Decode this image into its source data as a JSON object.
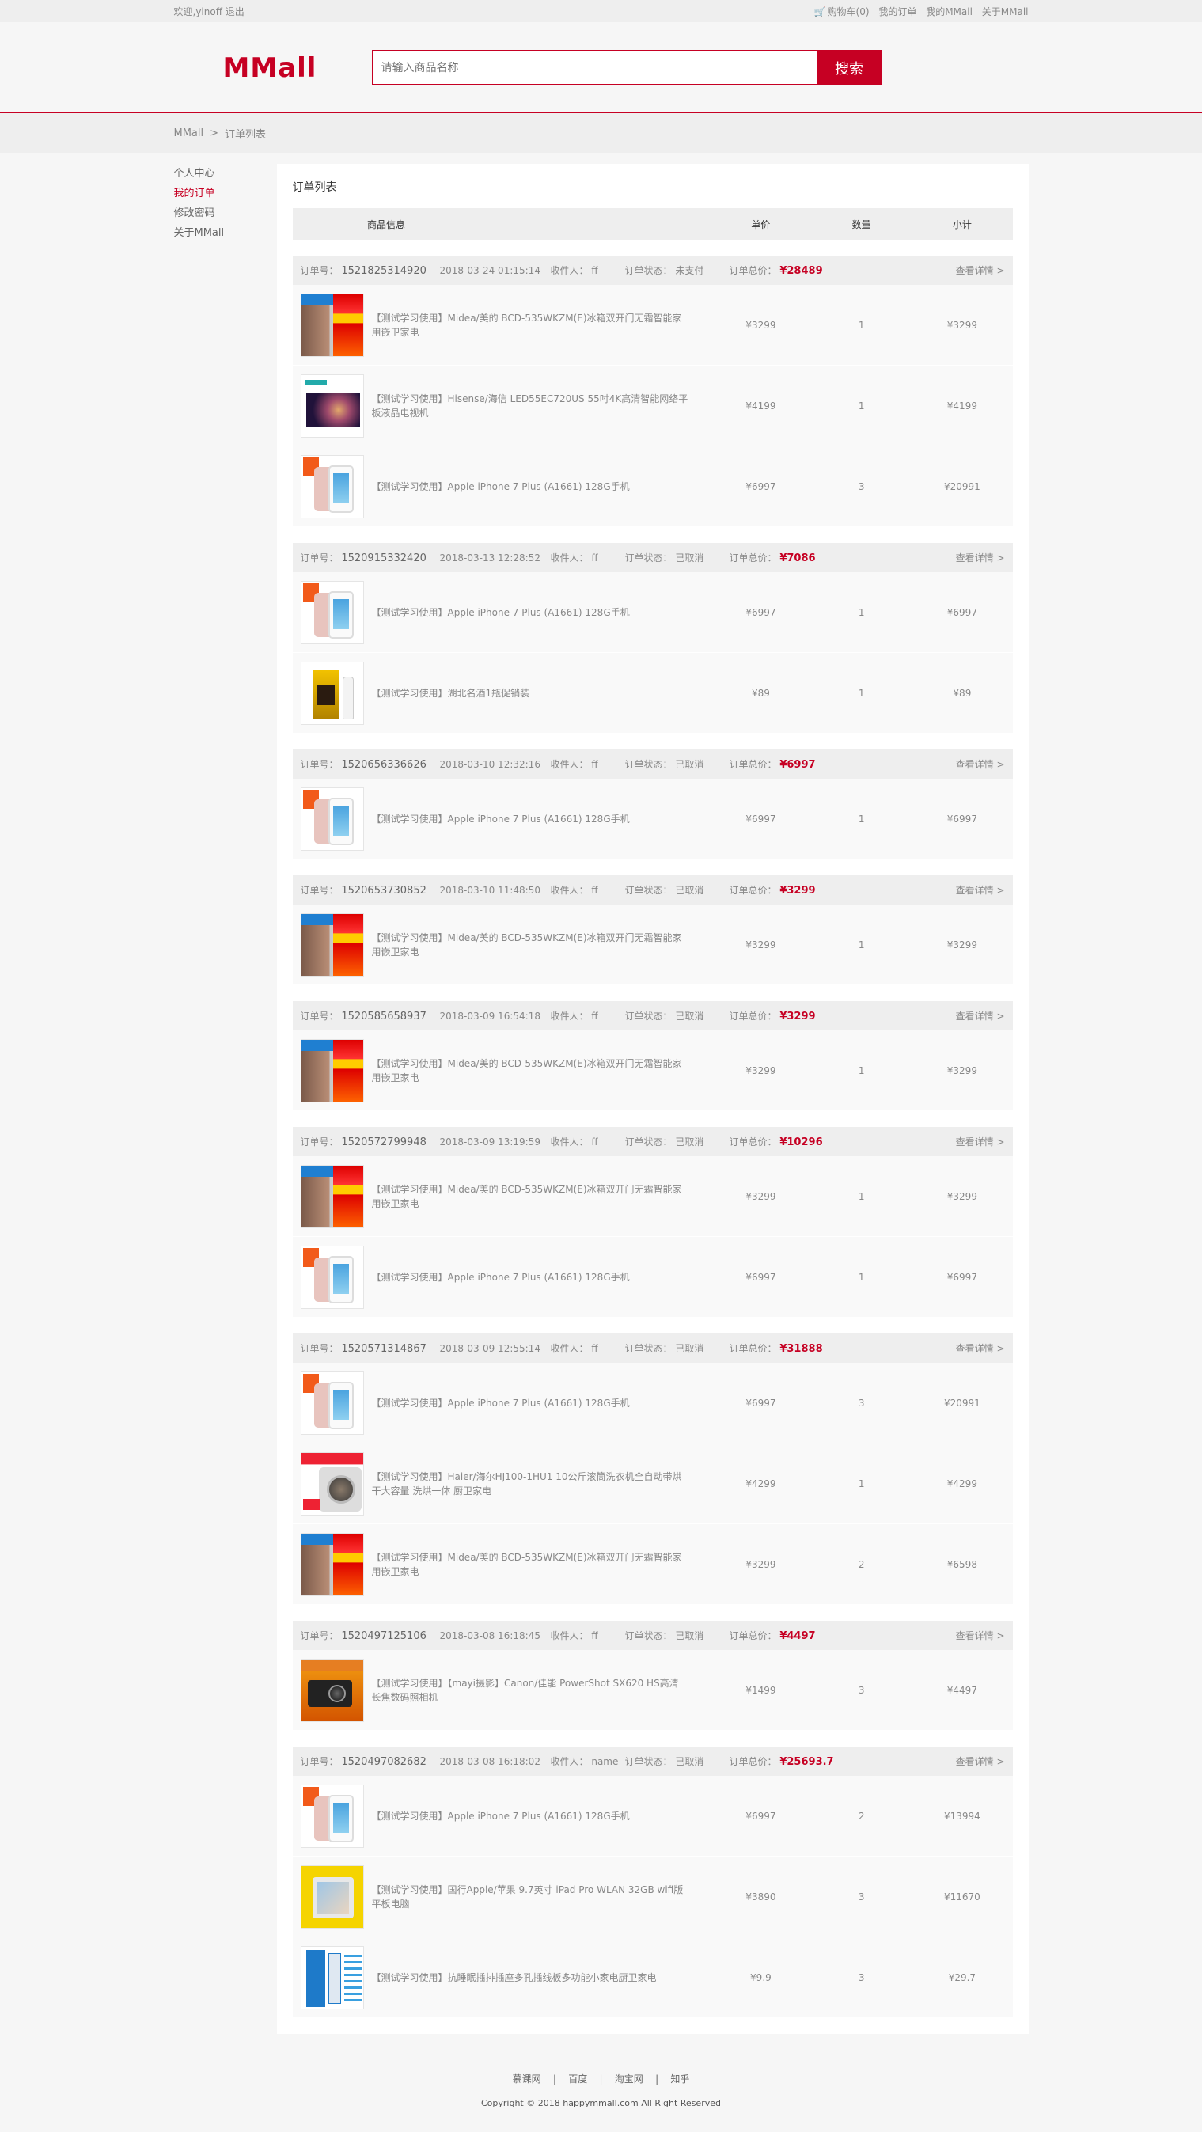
{
  "topbar": {
    "welcome": "欢迎,yinoff",
    "logout": "退出",
    "cart": "购物车(0)",
    "my_orders": "我的订单",
    "my_mmall": "我的MMall",
    "about": "关于MMall"
  },
  "header": {
    "logo": "MMall",
    "search_placeholder": "请输入商品名称",
    "search_button": "搜索"
  },
  "breadcrumb": {
    "home": "MMall",
    "sep": ">",
    "current": "订单列表"
  },
  "sidebar": {
    "items": [
      {
        "label": "个人中心",
        "active": false
      },
      {
        "label": "我的订单",
        "active": true
      },
      {
        "label": "修改密码",
        "active": false
      },
      {
        "label": "关于MMall",
        "active": false
      }
    ]
  },
  "content": {
    "title": "订单列表",
    "columns": [
      "商品信息",
      "单价",
      "数量",
      "小计"
    ]
  },
  "labels": {
    "order_no": "订单号：",
    "receiver": "收件人：",
    "status": "订单状态：",
    "total": "订单总价：",
    "detail": "查看详情 >"
  },
  "orders": [
    {
      "no": "1521825314920",
      "time": "2018-03-24 01:15:14",
      "receiver": "ff",
      "status": "未支付",
      "total": "¥28489",
      "items": [
        {
          "img": "fridge",
          "name": "【测试学习使用】Midea/美的 BCD-535WKZM(E)冰箱双开门无霜智能家用嵌卫家电",
          "price": "¥3299",
          "qty": "1",
          "subtotal": "¥3299"
        },
        {
          "img": "tv",
          "name": "【测试学习使用】Hisense/海信 LED55EC720US 55吋4K高清智能网络平板液晶电视机",
          "price": "¥4199",
          "qty": "1",
          "subtotal": "¥4199"
        },
        {
          "img": "phone",
          "name": "【测试学习使用】Apple iPhone 7 Plus (A1661) 128G手机",
          "price": "¥6997",
          "qty": "3",
          "subtotal": "¥20991"
        }
      ]
    },
    {
      "no": "1520915332420",
      "time": "2018-03-13 12:28:52",
      "receiver": "ff",
      "status": "已取消",
      "total": "¥7086",
      "items": [
        {
          "img": "phone",
          "name": "【测试学习使用】Apple iPhone 7 Plus (A1661) 128G手机",
          "price": "¥6997",
          "qty": "1",
          "subtotal": "¥6997"
        },
        {
          "img": "wine",
          "name": "【测试学习使用】湖北名酒1瓶促销装",
          "price": "¥89",
          "qty": "1",
          "subtotal": "¥89"
        }
      ]
    },
    {
      "no": "1520656336626",
      "time": "2018-03-10 12:32:16",
      "receiver": "ff",
      "status": "已取消",
      "total": "¥6997",
      "items": [
        {
          "img": "phone",
          "name": "【测试学习使用】Apple iPhone 7 Plus (A1661) 128G手机",
          "price": "¥6997",
          "qty": "1",
          "subtotal": "¥6997"
        }
      ]
    },
    {
      "no": "1520653730852",
      "time": "2018-03-10 11:48:50",
      "receiver": "ff",
      "status": "已取消",
      "total": "¥3299",
      "items": [
        {
          "img": "fridge",
          "name": "【测试学习使用】Midea/美的 BCD-535WKZM(E)冰箱双开门无霜智能家用嵌卫家电",
          "price": "¥3299",
          "qty": "1",
          "subtotal": "¥3299"
        }
      ]
    },
    {
      "no": "1520585658937",
      "time": "2018-03-09 16:54:18",
      "receiver": "ff",
      "status": "已取消",
      "total": "¥3299",
      "items": [
        {
          "img": "fridge",
          "name": "【测试学习使用】Midea/美的 BCD-535WKZM(E)冰箱双开门无霜智能家用嵌卫家电",
          "price": "¥3299",
          "qty": "1",
          "subtotal": "¥3299"
        }
      ]
    },
    {
      "no": "1520572799948",
      "time": "2018-03-09 13:19:59",
      "receiver": "ff",
      "status": "已取消",
      "total": "¥10296",
      "items": [
        {
          "img": "fridge",
          "name": "【测试学习使用】Midea/美的 BCD-535WKZM(E)冰箱双开门无霜智能家用嵌卫家电",
          "price": "¥3299",
          "qty": "1",
          "subtotal": "¥3299"
        },
        {
          "img": "phone",
          "name": "【测试学习使用】Apple iPhone 7 Plus (A1661) 128G手机",
          "price": "¥6997",
          "qty": "1",
          "subtotal": "¥6997"
        }
      ]
    },
    {
      "no": "1520571314867",
      "time": "2018-03-09 12:55:14",
      "receiver": "ff",
      "status": "已取消",
      "total": "¥31888",
      "items": [
        {
          "img": "phone",
          "name": "【测试学习使用】Apple iPhone 7 Plus (A1661) 128G手机",
          "price": "¥6997",
          "qty": "3",
          "subtotal": "¥20991"
        },
        {
          "img": "washer",
          "name": "【测试学习使用】Haier/海尔HJ100-1HU1 10公斤滚筒洗衣机全自动带烘干大容量 洗烘一体 厨卫家电",
          "price": "¥4299",
          "qty": "1",
          "subtotal": "¥4299"
        },
        {
          "img": "fridge",
          "name": "【测试学习使用】Midea/美的 BCD-535WKZM(E)冰箱双开门无霜智能家用嵌卫家电",
          "price": "¥3299",
          "qty": "2",
          "subtotal": "¥6598"
        }
      ]
    },
    {
      "no": "1520497125106",
      "time": "2018-03-08 16:18:45",
      "receiver": "ff",
      "status": "已取消",
      "total": "¥4497",
      "items": [
        {
          "img": "camera",
          "name": "【测试学习使用】【mayi摄影】Canon/佳能 PowerShot SX620 HS高清长焦数码照相机",
          "price": "¥1499",
          "qty": "3",
          "subtotal": "¥4497"
        }
      ]
    },
    {
      "no": "1520497082682",
      "time": "2018-03-08 16:18:02",
      "receiver": "name",
      "status": "已取消",
      "total": "¥25693.7",
      "items": [
        {
          "img": "phone",
          "name": "【测试学习使用】Apple iPhone 7 Plus (A1661) 128G手机",
          "price": "¥6997",
          "qty": "2",
          "subtotal": "¥13994"
        },
        {
          "img": "ipad",
          "name": "【测试学习使用】国行Apple/苹果 9.7英寸 iPad Pro WLAN 32GB wifi版平板电脑",
          "price": "¥3890",
          "qty": "3",
          "subtotal": "¥11670"
        },
        {
          "img": "strip",
          "name": "【测试学习使用】抗睡眠插排插座多孔插线板多功能小家电厨卫家电",
          "price": "¥9.9",
          "qty": "3",
          "subtotal": "¥29.7"
        }
      ]
    }
  ],
  "footer": {
    "links": [
      "慕课网",
      "百度",
      "淘宝网",
      "知乎"
    ],
    "copyright": "Copyright © 2018 happymmall.com All Right Reserved"
  },
  "colors": {
    "brand": "#c60023"
  }
}
